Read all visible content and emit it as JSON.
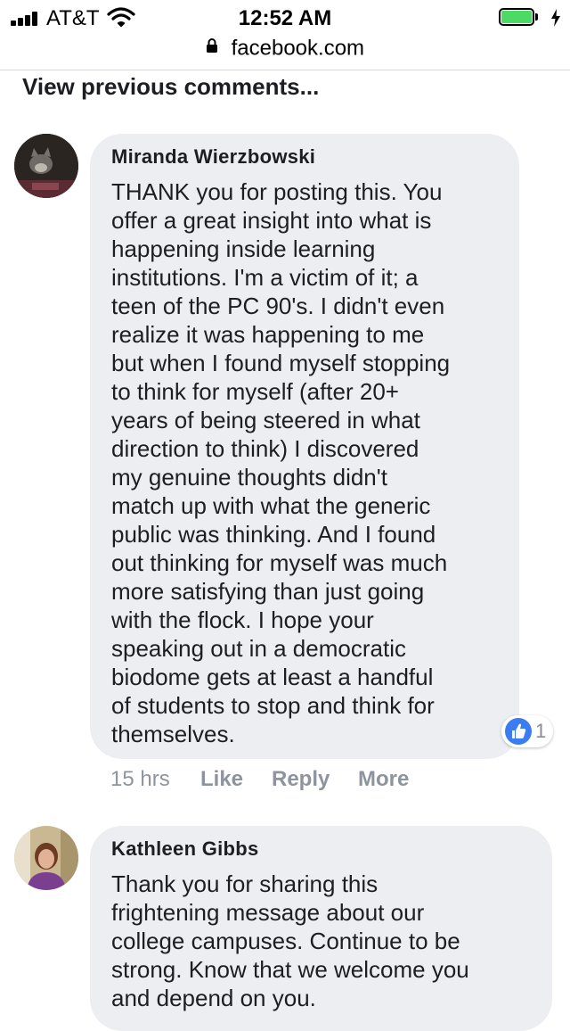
{
  "status_bar": {
    "carrier": "AT&T",
    "time": "12:52 AM",
    "battery_color": "#4cd964"
  },
  "url_bar": {
    "domain": "facebook.com",
    "icon": "lock-icon"
  },
  "view_previous": "View previous comments...",
  "comments": [
    {
      "author": "Miranda Wierzbowski",
      "lines": [
        "THANK you for posting this. You",
        "offer a great insight into what is",
        "happening inside learning",
        "institutions. I'm a victim of it; a",
        "teen of the PC 90's. I didn't even",
        "realize it was happening to me",
        "but when I found myself stopping",
        "to think for myself (after 20+",
        "years of being steered in what",
        "direction to think) I discovered",
        "my genuine thoughts didn't",
        "match up with what the generic",
        "public was thinking. And I found",
        "out thinking for myself was much",
        "more satisfying than just going",
        "with the flock. I hope your",
        "speaking out in a democratic",
        "biodome gets at least a handful",
        "of students to stop and think for",
        "themselves."
      ],
      "reaction_count": "1",
      "timestamp": "15 hrs",
      "actions": {
        "like": "Like",
        "reply": "Reply",
        "more": "More"
      }
    },
    {
      "author": "Kathleen Gibbs",
      "lines": [
        "Thank you for sharing this",
        "frightening message about our",
        "college campuses. Continue to be",
        "strong. Know that we welcome you",
        "and depend on you."
      ]
    }
  ],
  "colors": {
    "bubble": "#edeef2",
    "like_blue": "#3b7cf2",
    "meta_gray": "#8d949e"
  }
}
